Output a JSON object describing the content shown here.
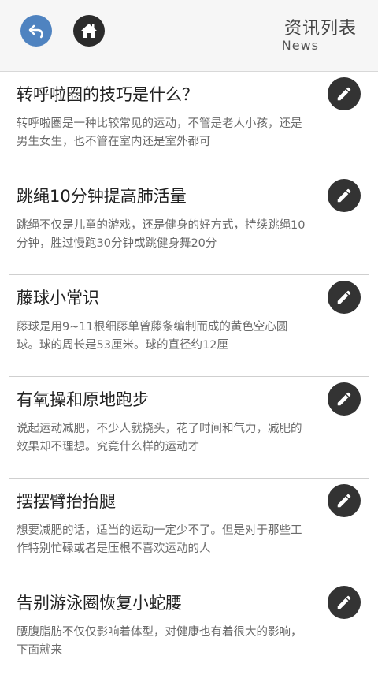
{
  "header": {
    "title": "资讯列表",
    "subtitle": "News",
    "back_icon": "back-arrow-icon",
    "home_icon": "home-icon"
  },
  "items": [
    {
      "title": "转呼啦圈的技巧是什么？",
      "summary": "转呼啦圈是一种比较常见的运动，不管是老人小孩，还是男生女生，也不管在室内还是室外都可"
    },
    {
      "title": "跳绳10分钟提高肺活量",
      "summary": "跳绳不仅是儿童的游戏，还是健身的好方式，持续跳绳10分钟，胜过慢跑30分钟或跳健身舞20分"
    },
    {
      "title": "藤球小常识",
      "summary": "藤球是用9~11根细藤单曾藤条编制而成的黄色空心圆球。球的周长是53厘米。球的直径约12厘"
    },
    {
      "title": "有氧操和原地跑步",
      "summary": "说起运动减肥，不少人就挠头，花了时间和气力，减肥的效果却不理想。究竟什么样的运动才"
    },
    {
      "title": "摆摆臂抬抬腿",
      "summary": "想要减肥的话，适当的运动一定少不了。但是对于那些工作特别忙碌或者是压根不喜欢运动的人"
    },
    {
      "title": "告别游泳圈恢复小蛇腰",
      "summary": "腰腹脂肪不仅仅影响着体型，对健康也有着很大的影响，下面就来"
    }
  ],
  "colors": {
    "back_button": "#4f83c0",
    "home_button": "#2b2b2b",
    "edit_button": "#333333"
  }
}
